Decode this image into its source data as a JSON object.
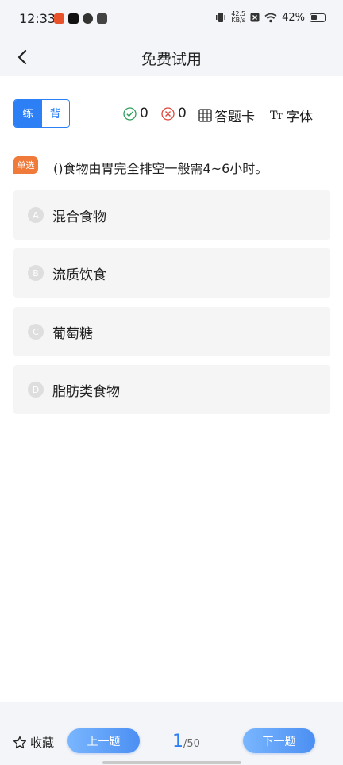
{
  "status_bar": {
    "time": "12:33",
    "net_speed_value": "42.5",
    "net_speed_unit": "KB/s",
    "battery_percent": "42%"
  },
  "nav": {
    "title": "免费试用"
  },
  "toolbar": {
    "mode_practice": "练",
    "mode_recite": "背",
    "correct_count": "0",
    "wrong_count": "0",
    "answer_card_label": "答题卡",
    "font_icon_text": "Tт",
    "font_label": "字体"
  },
  "question": {
    "type_tag": "单选",
    "text": "()食物由胃完全排空一般需4~6小时。",
    "options": [
      {
        "letter": "A",
        "text": "混合食物"
      },
      {
        "letter": "B",
        "text": "流质饮食"
      },
      {
        "letter": "C",
        "text": "葡萄糖"
      },
      {
        "letter": "D",
        "text": "脂肪类食物"
      }
    ]
  },
  "bottom": {
    "favorite_label": "收藏",
    "prev_label": "上一题",
    "next_label": "下一题",
    "current_page": "1",
    "total_pages": "/50"
  },
  "colors": {
    "accent": "#2d7ff5",
    "tag": "#f07a3a",
    "correct": "#2e9e5b",
    "wrong": "#e0463a"
  }
}
